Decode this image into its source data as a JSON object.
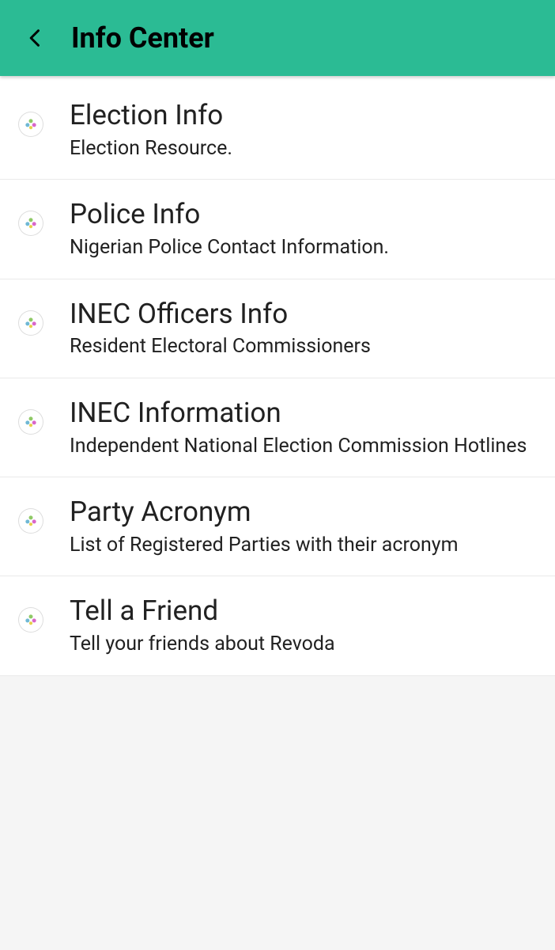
{
  "header": {
    "title": "Info Center"
  },
  "items": [
    {
      "title": "Election Info",
      "subtitle": "Election Resource."
    },
    {
      "title": "Police Info",
      "subtitle": "Nigerian Police Contact Information."
    },
    {
      "title": "INEC Officers Info",
      "subtitle": "Resident Electoral Commissioners"
    },
    {
      "title": "INEC Information",
      "subtitle": "Independent National Election Commission Hotlines"
    },
    {
      "title": "Party Acronym",
      "subtitle": "List of Registered Parties with their acronym"
    },
    {
      "title": "Tell a Friend",
      "subtitle": "Tell your friends about Revoda"
    }
  ]
}
